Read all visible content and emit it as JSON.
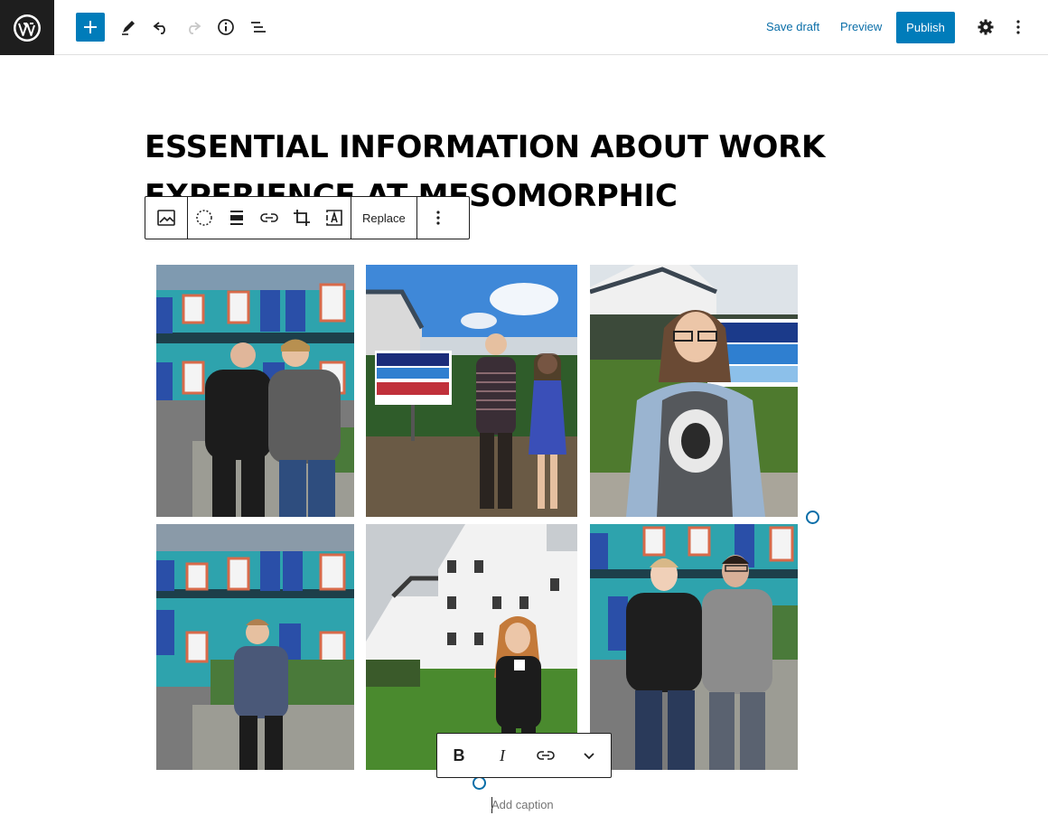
{
  "topbar": {
    "logo_icon": "wordpress-icon",
    "inserter_icon": "plus-icon",
    "tools_icon": "pencil-icon",
    "undo_icon": "undo-icon",
    "redo_icon": "redo-icon",
    "details_icon": "info-icon",
    "outline_icon": "list-view-icon",
    "save_draft": "Save draft",
    "preview": "Preview",
    "publish": "Publish",
    "settings_icon": "gear-icon",
    "options_icon": "more-vertical-icon"
  },
  "post": {
    "title": "ESSENTIAL INFORMATION ABOUT WORK EXPERIENCE AT MESOMORPHIC"
  },
  "block_toolbar": {
    "block_type_icon": "image-icon",
    "replace": "Replace",
    "more_icon": "more-vertical-icon"
  },
  "gallery": {
    "photos": [
      {
        "id": "photo-1",
        "subject": "two boys in front of teal building"
      },
      {
        "id": "photo-2",
        "subject": "boy and girl by mesomorphic sign"
      },
      {
        "id": "photo-3",
        "subject": "girl with glasses by sign"
      },
      {
        "id": "photo-4",
        "subject": "boy in front of teal building"
      },
      {
        "id": "photo-5",
        "subject": "woman in front of white house"
      },
      {
        "id": "photo-6",
        "subject": "two young men in front of teal building"
      }
    ]
  },
  "format_toolbar": {
    "bold": "B",
    "italic": "I",
    "link_icon": "link-icon",
    "more_icon": "chevron-down-icon"
  },
  "caption": {
    "placeholder": "Add caption"
  },
  "colors": {
    "accent": "#007cba",
    "dark": "#1e1e1e",
    "teal_building": "#2a9fa8"
  }
}
